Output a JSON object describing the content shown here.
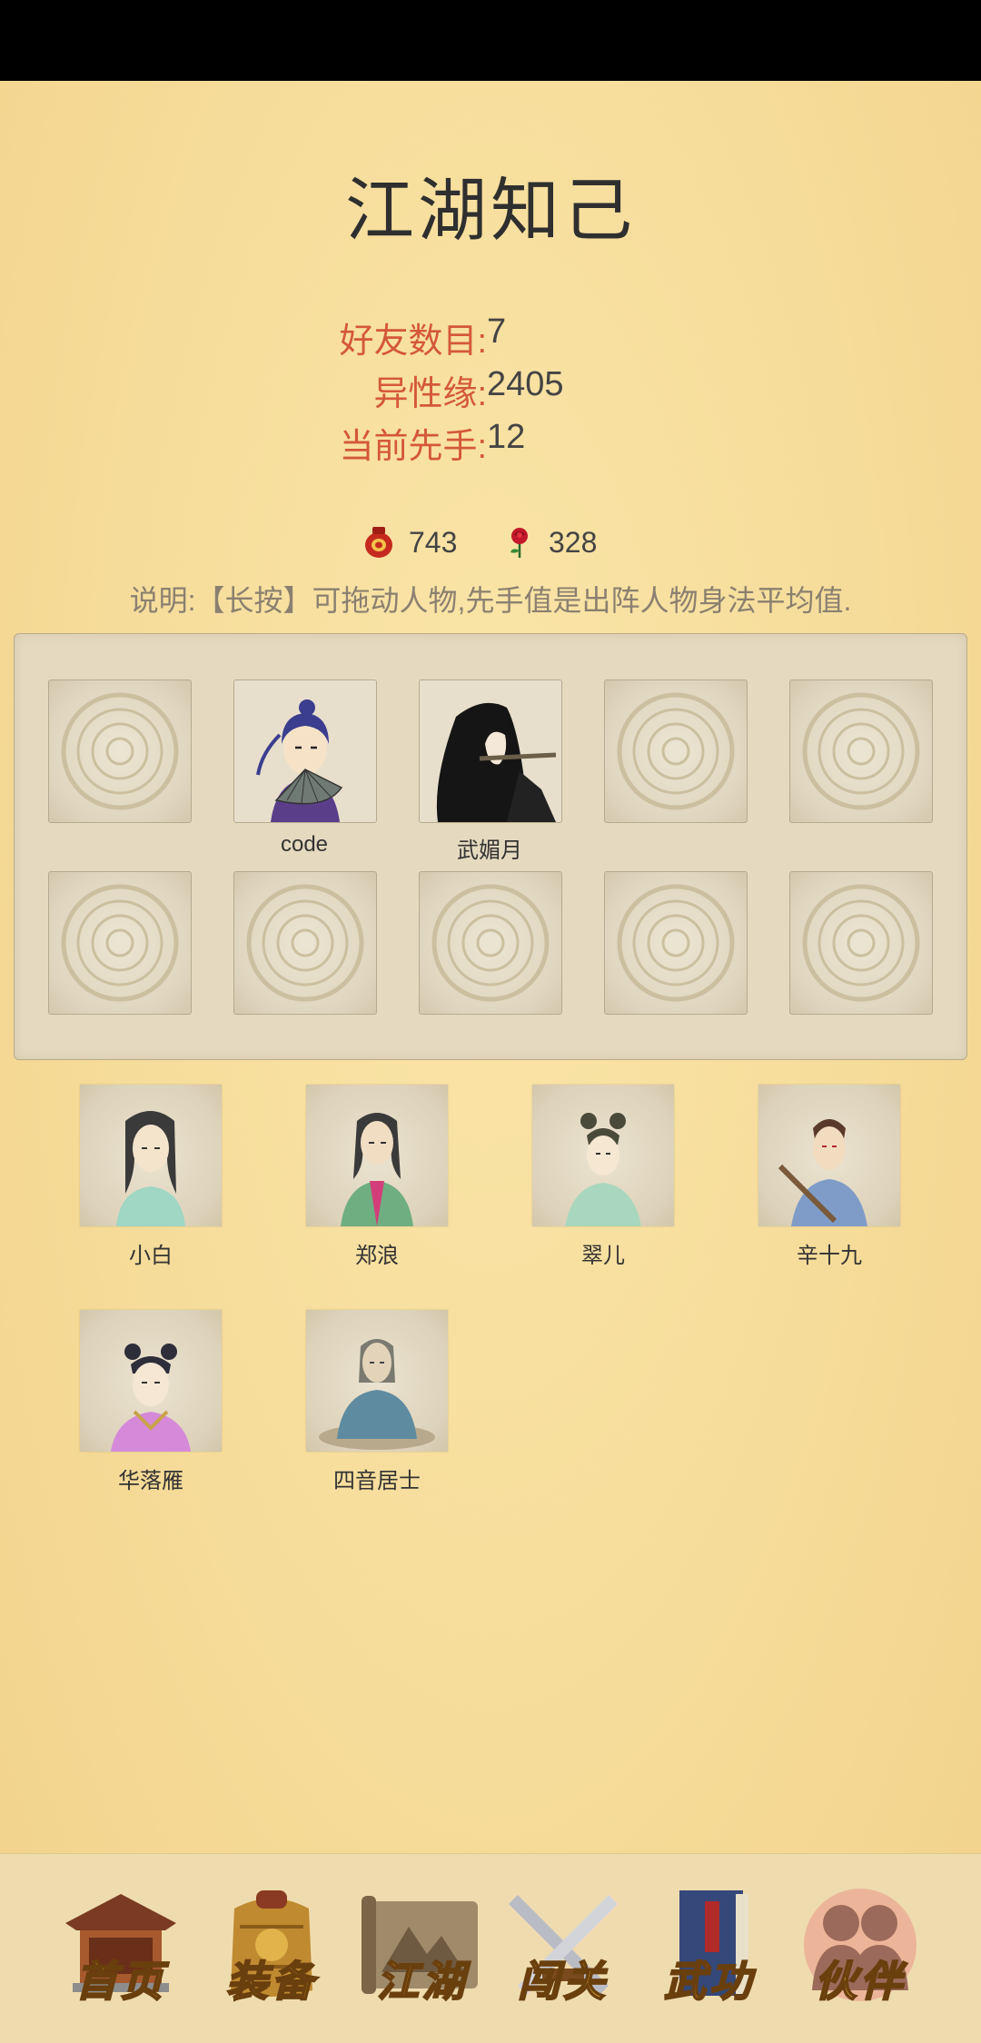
{
  "page": {
    "title": "江湖知己"
  },
  "stats": [
    {
      "label": "好友数目:",
      "value": "7"
    },
    {
      "label": "异性缘:",
      "value": "2405"
    },
    {
      "label": "当前先手:",
      "value": "12"
    }
  ],
  "currency": [
    {
      "icon": "red-jar-icon",
      "value": "743"
    },
    {
      "icon": "rose-icon",
      "value": "328"
    }
  ],
  "description": "说明:【长按】可拖动人物,先手值是出阵人物身法平均值.",
  "formation": {
    "slots": [
      {
        "name": "",
        "filled": false
      },
      {
        "name": "code",
        "filled": true,
        "icon": "fan-swordsman-portrait"
      },
      {
        "name": "武媚月",
        "filled": true,
        "icon": "flute-woman-portrait"
      },
      {
        "name": "",
        "filled": false
      },
      {
        "name": "",
        "filled": false
      },
      {
        "name": "",
        "filled": false
      },
      {
        "name": "",
        "filled": false
      },
      {
        "name": "",
        "filled": false
      },
      {
        "name": "",
        "filled": false
      },
      {
        "name": "",
        "filled": false
      }
    ]
  },
  "characters": [
    {
      "name": "小白",
      "icon": "xiaobai-portrait",
      "robe": "#9fd6c4"
    },
    {
      "name": "郑浪",
      "icon": "zhenglang-portrait",
      "robe": "#6fae80"
    },
    {
      "name": "翠儿",
      "icon": "cuier-portrait",
      "robe": "#a9d7bd"
    },
    {
      "name": "辛十九",
      "icon": "xinshijiu-portrait",
      "robe": "#7f9cc8"
    },
    {
      "name": "华落雁",
      "icon": "hualuoyan-portrait",
      "robe": "#d58ad9"
    },
    {
      "name": "四音居士",
      "icon": "siyinjushi-portrait",
      "robe": "#5f8ba0"
    }
  ],
  "nav": [
    {
      "label": "首页",
      "icon": "pavilion-icon"
    },
    {
      "label": "装备",
      "icon": "armor-icon"
    },
    {
      "label": "江湖",
      "icon": "map-scroll-icon"
    },
    {
      "label": "闯关",
      "icon": "crossed-swords-icon"
    },
    {
      "label": "武功",
      "icon": "book-icon"
    },
    {
      "label": "伙伴",
      "icon": "companions-icon",
      "active": true
    }
  ],
  "colors": {
    "accent_red": "#d4583a",
    "text": "#444444",
    "nav_gold": "#e3b12e"
  }
}
